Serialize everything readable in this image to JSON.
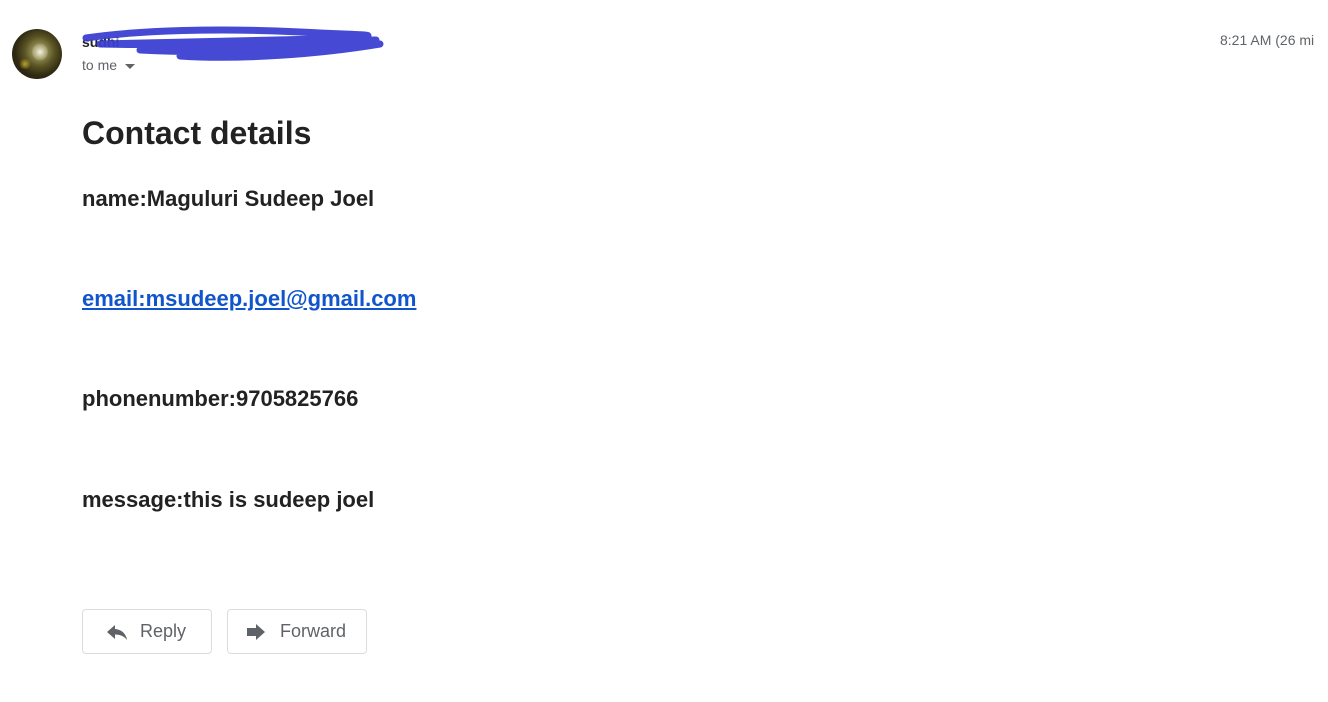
{
  "message": {
    "sender": "sudhi",
    "recipient_label": "to me",
    "timestamp": "8:21 AM (26 mi",
    "heading": "Contact details",
    "fields": {
      "name": "name:Maguluri Sudeep Joel",
      "email": "email:msudeep.joel@gmail.com",
      "phone": "phonenumber:9705825766",
      "message": "message:this is sudeep joel"
    }
  },
  "actions": {
    "reply_label": "Reply",
    "forward_label": "Forward"
  },
  "colors": {
    "link": "#1155cc",
    "redaction": "#3b3fd1"
  },
  "icons": {
    "reply": "reply-arrow-icon",
    "forward": "forward-arrow-icon",
    "recipient_details": "caret-down-icon"
  }
}
